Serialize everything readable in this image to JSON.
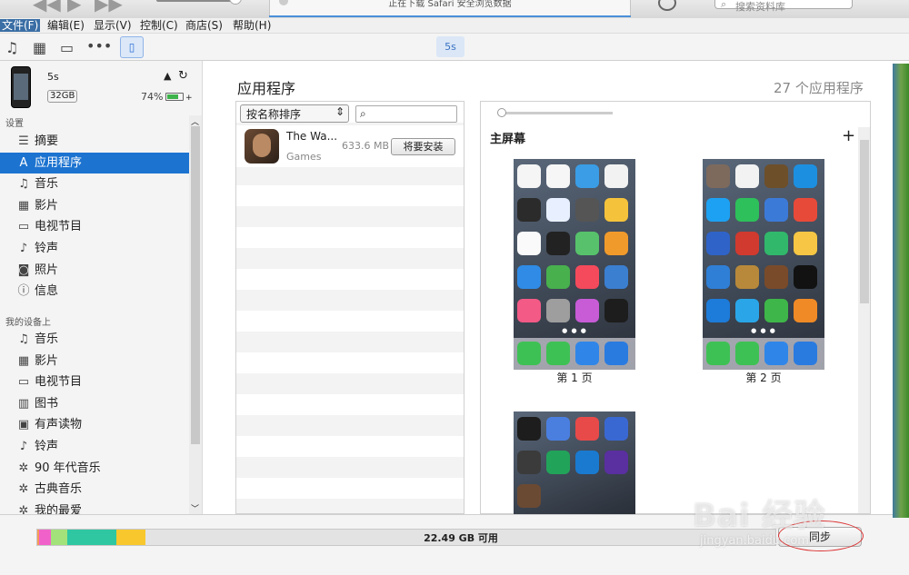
{
  "titlebar": {
    "download_status": "正在下载 Safari 安全浏览数据",
    "search_placeholder": "搜索资料库"
  },
  "menu": {
    "items": [
      "文件(F)",
      "编辑(E)",
      "显示(V)",
      "控制(C)",
      "商店(S)",
      "帮助(H)"
    ],
    "active_index": 0
  },
  "toolbar": {
    "device_pill": "5s"
  },
  "device": {
    "name": "5s",
    "capacity": "32GB",
    "battery": "74%",
    "battery_level": 0.74
  },
  "sidebar": {
    "settings_header": "设置",
    "settings_items": [
      {
        "icon": "summary-icon",
        "label": "摘要",
        "selected": false
      },
      {
        "icon": "appstore-icon",
        "label": "应用程序",
        "selected": true
      },
      {
        "icon": "music-icon",
        "label": "音乐",
        "selected": false
      },
      {
        "icon": "film-icon",
        "label": "影片",
        "selected": false
      },
      {
        "icon": "tv-icon",
        "label": "电视节目",
        "selected": false
      },
      {
        "icon": "bell-icon",
        "label": "铃声",
        "selected": false
      },
      {
        "icon": "camera-icon",
        "label": "照片",
        "selected": false
      },
      {
        "icon": "info-icon",
        "label": "信息",
        "selected": false
      }
    ],
    "ondevice_header": "我的设备上",
    "ondevice_items": [
      {
        "icon": "music-icon",
        "label": "音乐"
      },
      {
        "icon": "film-icon",
        "label": "影片"
      },
      {
        "icon": "tv-icon",
        "label": "电视节目"
      },
      {
        "icon": "book-icon",
        "label": "图书"
      },
      {
        "icon": "audiobook-icon",
        "label": "有声读物"
      },
      {
        "icon": "bell-icon",
        "label": "铃声"
      },
      {
        "icon": "gear-icon",
        "label": "90 年代音乐"
      },
      {
        "icon": "gear-icon",
        "label": "古典音乐"
      },
      {
        "icon": "gear-icon",
        "label": "我的最爱"
      }
    ]
  },
  "apps": {
    "title": "应用程序",
    "count": "27 个应用程序",
    "sort_label": "按名称排序",
    "list": [
      {
        "name": "The Wa...",
        "category": "Games",
        "size": "633.6 MB",
        "action": "将要安装"
      }
    ]
  },
  "screens": {
    "home_label": "主屏幕",
    "pages": [
      "第 1 页",
      "第 2 页"
    ],
    "page1_apps": [
      "#f5f5f5",
      "#f6f6f6",
      "#3a9de5",
      "#f2f2f2",
      "#2b2b2b",
      "#e8f0ff",
      "#555",
      "#f5c33b",
      "#fafafa",
      "#222",
      "#57c26b",
      "#f19a2c",
      "#2f8be6",
      "#48b04d",
      "#f44a5c",
      "#3b7fd1",
      "#f35a86",
      "#9e9e9e",
      "#c75cd6",
      "#1d1d1d"
    ],
    "page2_apps": [
      "#7d6a5d",
      "#f2f2f2",
      "#6d4f2a",
      "#1d8fe0",
      "#1da1f2",
      "#2ec05a",
      "#3c7ad8",
      "#e84a3a",
      "#2f63c7",
      "#d13a2f",
      "#31b86b",
      "#f6c644",
      "#2f7fd6",
      "#b8893a",
      "#7a4b2a",
      "#121212",
      "#1d7bd9",
      "#2aa6e8",
      "#3fb649",
      "#f08a26"
    ],
    "page3_apps": [
      "#1d1d1d",
      "#4a7fe0",
      "#e84a4a",
      "#3a68d2",
      "#3b3b3b",
      "#22a35a",
      "#1a7ad0",
      "#5a2fa0",
      "#6b4a33"
    ],
    "dock": [
      "#3ec154",
      "#3ec154",
      "#2f86e8",
      "#2a7be0"
    ]
  },
  "storage": {
    "free_text": "22.49 GB 可用",
    "segments": [
      {
        "color": "#f59a55",
        "fraction": 0.003
      },
      {
        "color": "#f062c9",
        "fraction": 0.016
      },
      {
        "color": "#a3e27a",
        "fraction": 0.022
      },
      {
        "color": "#2ec7a2",
        "fraction": 0.066
      },
      {
        "color": "#f7c72d",
        "fraction": 0.04
      }
    ],
    "sync_label": "同步"
  },
  "watermark": {
    "brand": "Bai 经验",
    "url": "jingyan.baidu.com"
  }
}
